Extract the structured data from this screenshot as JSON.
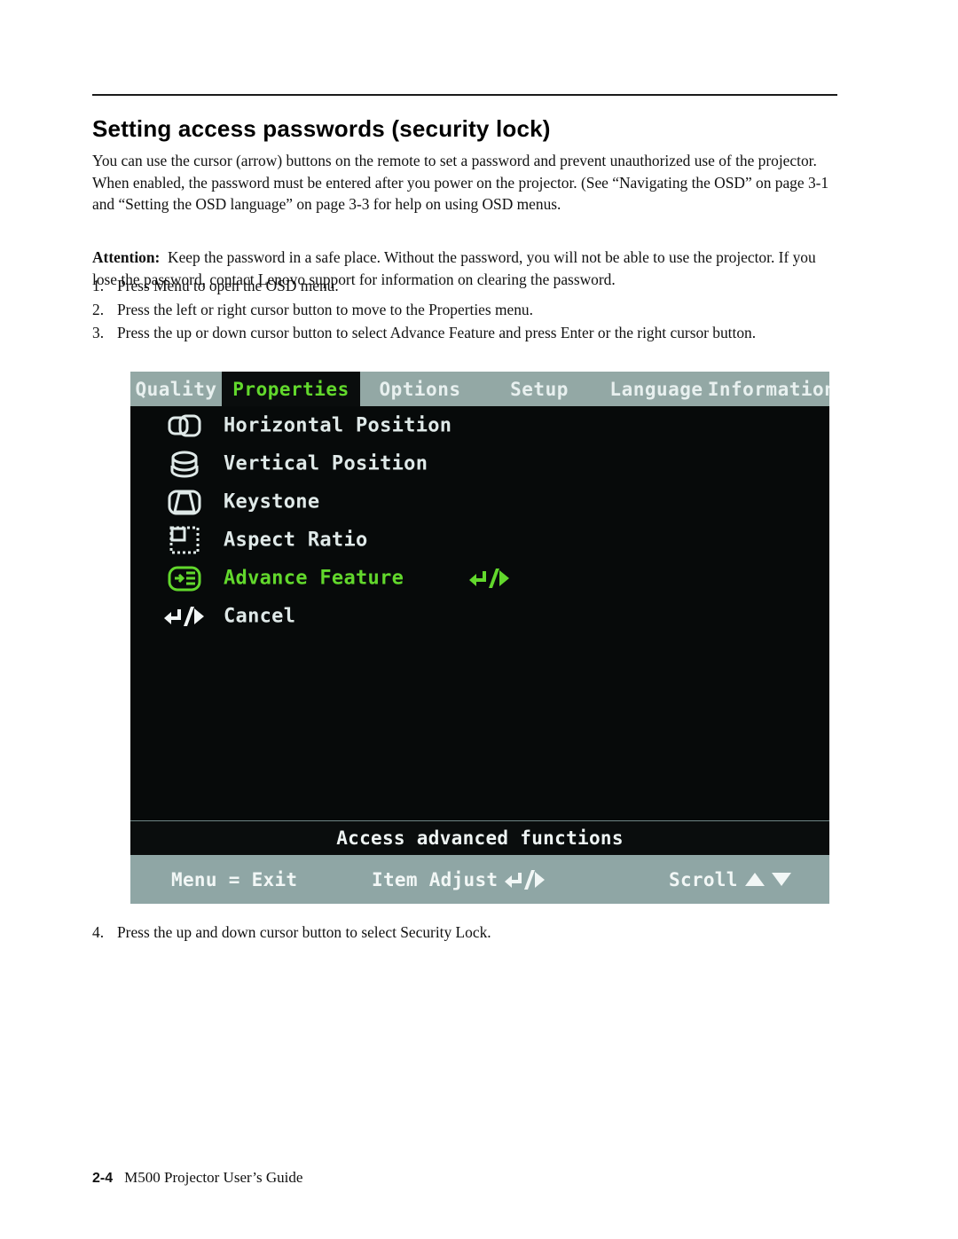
{
  "document": {
    "heading": "Setting access passwords (security lock)",
    "intro_paragraph": "You can use the cursor (arrow) buttons on the remote to set a password and prevent unauthorized use of the projector. When enabled, the password must be entered after you power on the projector. (See “Navigating the OSD” on page 3-1 and “Setting the OSD language” on page 3-3 for help on using OSD menus.",
    "attention_label": "Attention:",
    "attention_text": "Keep the password in a safe place. Without the password, you will not be able to use the projector. If you lose the password, contact Lenovo support for information on clearing the password.",
    "steps": [
      {
        "num": "1.",
        "text": "Press Menu to open the OSD menu."
      },
      {
        "num": "2.",
        "text": "Press the left or right cursor button to move to the Properties menu."
      },
      {
        "num": "3.",
        "text": "Press the up or down cursor button to select Advance Feature and press Enter or the right cursor button."
      },
      {
        "num": "4.",
        "text": "Press the up and down cursor button to select Security Lock."
      }
    ],
    "footer": {
      "page_number": "2-4",
      "title": "M500 Projector User’s Guide"
    }
  },
  "osd": {
    "tabs": [
      {
        "label": "Quality",
        "active": false
      },
      {
        "label": "Properties",
        "active": true
      },
      {
        "label": "Options",
        "active": false
      },
      {
        "label": "Setup",
        "active": false
      },
      {
        "label": "Language",
        "active": false
      },
      {
        "label": "Information",
        "active": false
      }
    ],
    "menu_items": [
      {
        "label": "Horizontal Position",
        "icon": "horizontal-position-icon",
        "selected": false,
        "value_glyph": ""
      },
      {
        "label": "Vertical Position",
        "icon": "vertical-position-icon",
        "selected": false,
        "value_glyph": ""
      },
      {
        "label": "Keystone",
        "icon": "keystone-icon",
        "selected": false,
        "value_glyph": ""
      },
      {
        "label": "Aspect Ratio",
        "icon": "aspect-ratio-icon",
        "selected": false,
        "value_glyph": ""
      },
      {
        "label": "Advance Feature",
        "icon": "advance-feature-icon",
        "selected": true,
        "value_glyph": "enter-slash-right"
      },
      {
        "label": "Cancel",
        "icon": "enter-slash-right-icon",
        "selected": false,
        "value_glyph": ""
      }
    ],
    "help_text": "Access advanced functions",
    "nav": {
      "exit_label": "Menu = Exit",
      "adjust_label": "Item Adjust",
      "adjust_glyph": "enter-slash-right",
      "scroll_label": "Scroll",
      "scroll_glyphs": "up-triangle down-triangle"
    },
    "colors": {
      "tab_bar_bg": "#93a8a5",
      "panel_bg": "#070a0a",
      "highlight_green": "#62d82c",
      "text_white": "#dfe9e8",
      "nav_bar_bg": "#8fa6a5"
    }
  }
}
